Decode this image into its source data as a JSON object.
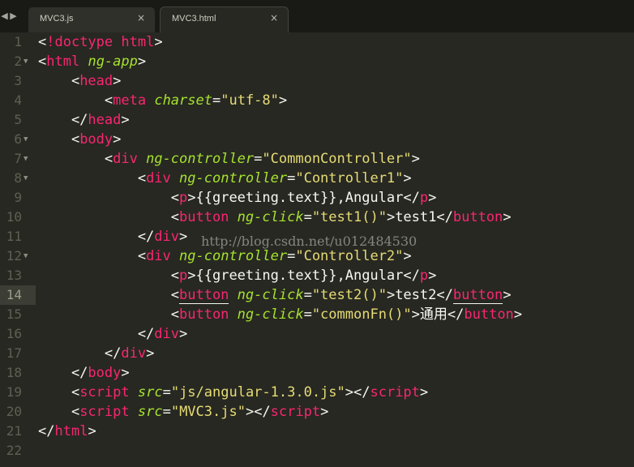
{
  "tabs": [
    {
      "label": "MVC3.js",
      "close": "×",
      "active": false
    },
    {
      "label": "MVC3.html",
      "close": "×",
      "active": true
    }
  ],
  "tab_nav": {
    "prev": "◀",
    "next": "▶"
  },
  "current_line": 14,
  "folded_lines": [
    2,
    6,
    7,
    8,
    12
  ],
  "lines": [
    [
      [
        "p",
        "<"
      ],
      [
        "t",
        "!doctype html"
      ],
      [
        "p",
        ">"
      ]
    ],
    [
      [
        "p",
        "<"
      ],
      [
        "t",
        "html"
      ],
      [
        "p",
        " "
      ],
      [
        "a",
        "ng-app"
      ],
      [
        "p",
        ">"
      ]
    ],
    [
      [
        "p",
        "    <"
      ],
      [
        "t",
        "head"
      ],
      [
        "p",
        ">"
      ]
    ],
    [
      [
        "p",
        "        <"
      ],
      [
        "t",
        "meta"
      ],
      [
        "p",
        " "
      ],
      [
        "a",
        "charset"
      ],
      [
        "p",
        "="
      ],
      [
        "s",
        "\"utf-8\""
      ],
      [
        "p",
        ">"
      ]
    ],
    [
      [
        "p",
        "    </"
      ],
      [
        "t",
        "head"
      ],
      [
        "p",
        ">"
      ]
    ],
    [
      [
        "p",
        "    <"
      ],
      [
        "t",
        "body"
      ],
      [
        "p",
        ">"
      ]
    ],
    [
      [
        "p",
        "        <"
      ],
      [
        "t",
        "div"
      ],
      [
        "p",
        " "
      ],
      [
        "a",
        "ng-controller"
      ],
      [
        "p",
        "="
      ],
      [
        "s",
        "\"CommonController\""
      ],
      [
        "p",
        ">"
      ]
    ],
    [
      [
        "p",
        "            <"
      ],
      [
        "t",
        "div"
      ],
      [
        "p",
        " "
      ],
      [
        "a",
        "ng-controller"
      ],
      [
        "p",
        "="
      ],
      [
        "s",
        "\"Controller1\""
      ],
      [
        "p",
        ">"
      ]
    ],
    [
      [
        "p",
        "                <"
      ],
      [
        "t",
        "p"
      ],
      [
        "p",
        ">"
      ],
      [
        "x",
        "{{greeting.text}},Angular"
      ],
      [
        "p",
        "</"
      ],
      [
        "t",
        "p"
      ],
      [
        "p",
        ">"
      ]
    ],
    [
      [
        "p",
        "                <"
      ],
      [
        "t",
        "button"
      ],
      [
        "p",
        " "
      ],
      [
        "a",
        "ng-click"
      ],
      [
        "p",
        "="
      ],
      [
        "s",
        "\"test1()\""
      ],
      [
        "p",
        ">"
      ],
      [
        "x",
        "test1"
      ],
      [
        "p",
        "</"
      ],
      [
        "t",
        "button"
      ],
      [
        "p",
        ">"
      ]
    ],
    [
      [
        "p",
        "            </"
      ],
      [
        "t",
        "div"
      ],
      [
        "p",
        ">"
      ]
    ],
    [
      [
        "p",
        "            <"
      ],
      [
        "t",
        "div"
      ],
      [
        "p",
        " "
      ],
      [
        "a",
        "ng-controller"
      ],
      [
        "p",
        "="
      ],
      [
        "s",
        "\"Controller2\""
      ],
      [
        "p",
        ">"
      ]
    ],
    [
      [
        "p",
        "                <"
      ],
      [
        "t",
        "p"
      ],
      [
        "p",
        ">"
      ],
      [
        "x",
        "{{greeting.text}},Angular"
      ],
      [
        "p",
        "</"
      ],
      [
        "t",
        "p"
      ],
      [
        "p",
        ">"
      ]
    ],
    [
      [
        "p",
        "                <"
      ],
      [
        "tu",
        "button"
      ],
      [
        "p",
        " "
      ],
      [
        "a",
        "ng-click"
      ],
      [
        "p",
        "="
      ],
      [
        "s",
        "\"test2()\""
      ],
      [
        "p",
        ">"
      ],
      [
        "x",
        "test2"
      ],
      [
        "p",
        "</"
      ],
      [
        "tu",
        "button"
      ],
      [
        "p",
        ">"
      ]
    ],
    [
      [
        "p",
        "                <"
      ],
      [
        "t",
        "button"
      ],
      [
        "p",
        " "
      ],
      [
        "a",
        "ng-click"
      ],
      [
        "p",
        "="
      ],
      [
        "s",
        "\"commonFn()\""
      ],
      [
        "p",
        ">"
      ],
      [
        "x",
        "通用"
      ],
      [
        "p",
        "</"
      ],
      [
        "t",
        "button"
      ],
      [
        "p",
        ">"
      ]
    ],
    [
      [
        "p",
        "            </"
      ],
      [
        "t",
        "div"
      ],
      [
        "p",
        ">"
      ]
    ],
    [
      [
        "p",
        "        </"
      ],
      [
        "t",
        "div"
      ],
      [
        "p",
        ">"
      ]
    ],
    [
      [
        "p",
        "    </"
      ],
      [
        "t",
        "body"
      ],
      [
        "p",
        ">"
      ]
    ],
    [
      [
        "p",
        "    <"
      ],
      [
        "t",
        "script"
      ],
      [
        "p",
        " "
      ],
      [
        "a",
        "src"
      ],
      [
        "p",
        "="
      ],
      [
        "s",
        "\"js/angular-1.3.0.js\""
      ],
      [
        "p",
        "></"
      ],
      [
        "t",
        "script"
      ],
      [
        "p",
        ">"
      ]
    ],
    [
      [
        "p",
        "    <"
      ],
      [
        "t",
        "script"
      ],
      [
        "p",
        " "
      ],
      [
        "a",
        "src"
      ],
      [
        "p",
        "="
      ],
      [
        "s",
        "\"MVC3.js\""
      ],
      [
        "p",
        "></"
      ],
      [
        "t",
        "script"
      ],
      [
        "p",
        ">"
      ]
    ],
    [
      [
        "p",
        "</"
      ],
      [
        "t",
        "html"
      ],
      [
        "p",
        ">"
      ]
    ],
    []
  ],
  "watermark": "http://blog.csdn.net/u012484530",
  "colors": {
    "background": "#272822",
    "tag": "#f92672",
    "attribute": "#a6e22e",
    "string": "#e6db74",
    "text": "#f8f8f2"
  }
}
